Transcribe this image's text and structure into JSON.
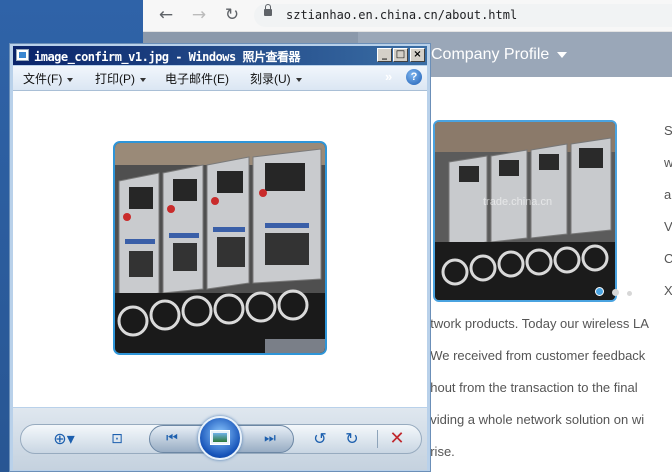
{
  "browser": {
    "url": "sztianhao.en.china.cn/about.html",
    "nav": {
      "company_profile": "Company Profile"
    },
    "watermark": "trade.china.cn",
    "side_letters": [
      "S",
      "w",
      "a",
      "V",
      "C",
      "X"
    ],
    "paragraph_lines": [
      "etwork products. Today our wireless LA",
      ". We received from customer feedback",
      "ghout from the transaction to the final",
      "oviding a whole network solution on wi",
      "prise."
    ]
  },
  "viewer": {
    "title": "image_confirm_v1.jpg - Windows 照片查看器",
    "menu": [
      "文件(F)",
      "打印(P)",
      "电子邮件(E)",
      "刻录(U)"
    ],
    "overflow": "»",
    "help": "?"
  },
  "icons": {
    "back": "back-arrow-icon",
    "forward": "forward-arrow-icon",
    "reload": "reload-icon",
    "lock": "lock-icon",
    "zoom": "zoom-icon",
    "actual_size": "actual-size-icon",
    "previous": "previous-icon",
    "slideshow": "slideshow-icon",
    "next": "next-icon",
    "rotate_ccw": "rotate-counterclockwise-icon",
    "rotate_cw": "rotate-clockwise-icon",
    "delete": "delete-icon"
  },
  "colors": {
    "titlebar": "#0a246a",
    "accent": "#2e95d8",
    "site_nav": "#9aa7b8",
    "delete_red": "#c0282d"
  }
}
